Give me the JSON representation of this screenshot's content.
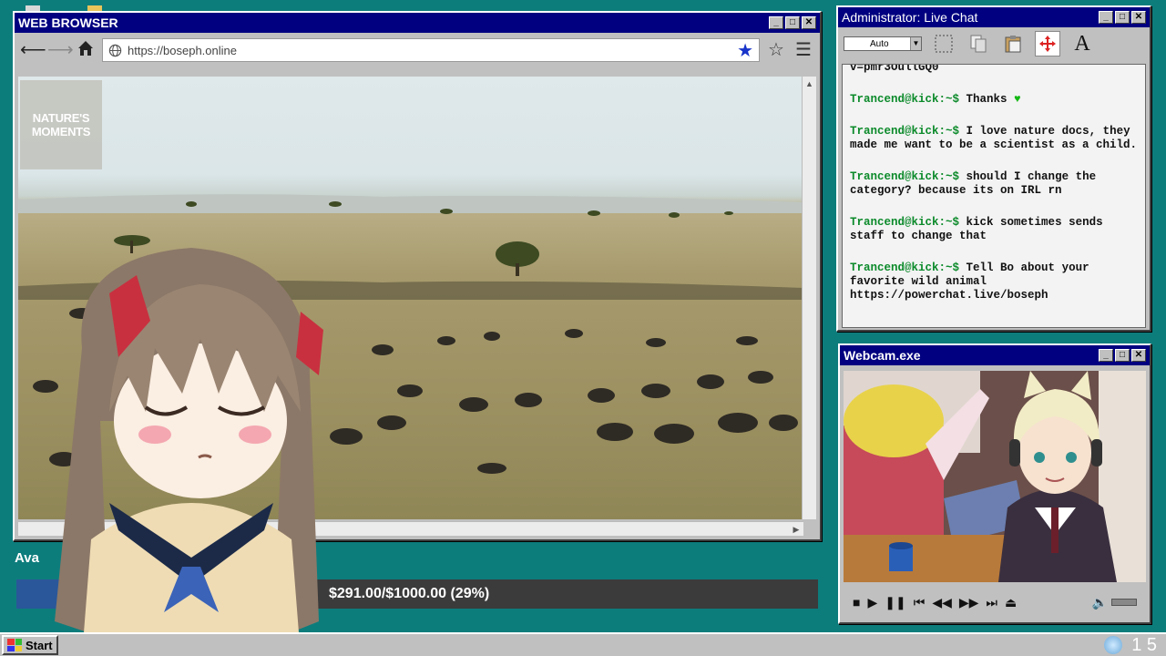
{
  "browser": {
    "title": "WEB BROWSER",
    "url": "https://boseph.online",
    "watermark": "NATURE'S MOMENTS"
  },
  "chat": {
    "title": "Administrator: Live Chat",
    "font_select": "Auto",
    "partial_line": "v=pmr3OullGQ0",
    "messages": [
      {
        "nick": "Trancend@kick:~$",
        "text": "Thanks"
      },
      {
        "nick": "Trancend@kick:~$",
        "text": "I love nature docs, they made me want to be a scientist as a child."
      },
      {
        "nick": "Trancend@kick:~$",
        "text": "should I change the category? because its on IRL rn"
      },
      {
        "nick": "Trancend@kick:~$",
        "text": "kick sometimes sends staff to change that"
      },
      {
        "nick": "Trancend@kick:~$",
        "text": "Tell Bo about your favorite wild animal https://powerchat.live/boseph"
      }
    ]
  },
  "webcam": {
    "title": "Webcam.exe"
  },
  "donation": {
    "donor": "Ava",
    "goal_text": "$291.00/$1000.00 (29%)",
    "progress_percent": 29
  },
  "taskbar": {
    "start_label": "Start",
    "clock": "1 5"
  },
  "colors": {
    "desktop": "#0d7d7c",
    "titlebar": "#000080",
    "chat_nick": "#0b8a2a",
    "goal_fill": "#2a5799"
  }
}
